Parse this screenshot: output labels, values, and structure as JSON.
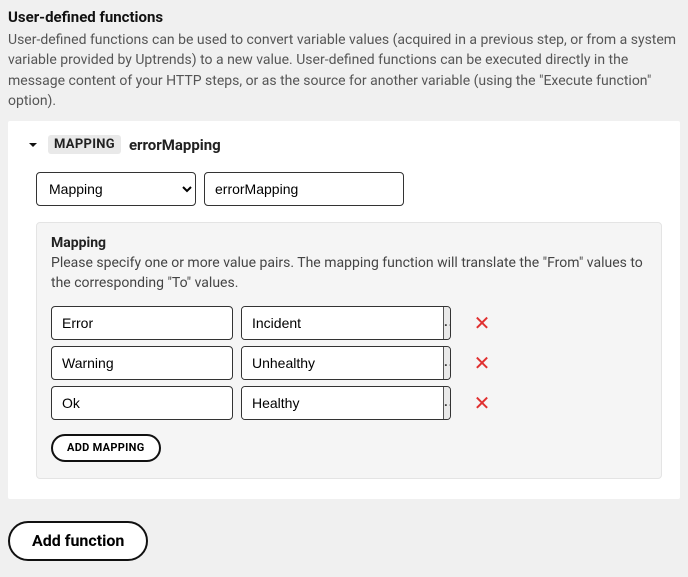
{
  "section": {
    "title": "User-defined functions",
    "description": "User-defined functions can be used to convert variable values (acquired in a previous step, or from a system variable provided by Uptrends) to a new value. User-defined functions can be executed directly in the message content of your HTTP steps, or as the source for another variable (using the \"Execute function\" option)."
  },
  "card": {
    "tag": "MAPPING",
    "name": "errorMapping",
    "type_select": "Mapping",
    "name_input": "errorMapping"
  },
  "mapping_box": {
    "title": "Mapping",
    "description": "Please specify one or more value pairs. The mapping function will translate the \"From\" values to the corresponding \"To\" values.",
    "pairs": [
      {
        "from": "Error",
        "to": "Incident"
      },
      {
        "from": "Warning",
        "to": "Unhealthy"
      },
      {
        "from": "Ok",
        "to": "Healthy"
      }
    ],
    "picker_label": "...",
    "add_button": "ADD MAPPING"
  },
  "footer": {
    "add_function": "Add function"
  },
  "icons": {
    "delete": "✕"
  }
}
